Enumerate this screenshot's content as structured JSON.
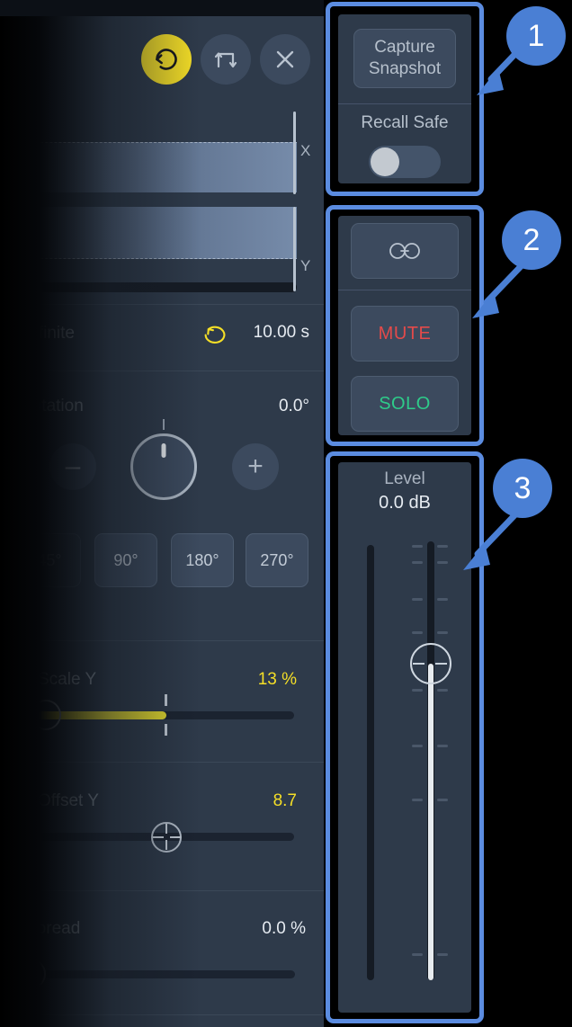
{
  "app": {
    "panel_background": "#2e3a4a",
    "accent_yellow": "#f5df27",
    "accent_blue": "#5b8ce0",
    "mute_color": "#e34a4a",
    "solo_color": "#2ecc8a"
  },
  "transport": {
    "loop_label": "loop-active",
    "bounce_label": "ping-pong",
    "close_label": "close"
  },
  "lanes": {
    "x_label": "X",
    "y_label": "Y"
  },
  "time_row": {
    "mode_label": "s: infinite",
    "loop_icon": "loop-icon",
    "duration": "10.00 s"
  },
  "rotation": {
    "label": "Rotation",
    "value": "0.0°",
    "minus_label": "–",
    "plus_label": "+",
    "presets": [
      {
        "label": "45°",
        "dim": true
      },
      {
        "label": "90°",
        "dim": false
      },
      {
        "label": "180°",
        "dim": false
      },
      {
        "label": "270°",
        "dim": false
      }
    ]
  },
  "scale_y": {
    "label": "Scale Y",
    "value": "13 %"
  },
  "offset_y": {
    "label": "Offset Y",
    "value": "8.7"
  },
  "spread": {
    "label": "Spread",
    "value": "0.0 %"
  },
  "snapshot_group": {
    "capture_line1": "Capture",
    "capture_line2": "Snapshot",
    "recall_safe_label": "Recall Safe",
    "recall_safe_state": "off"
  },
  "channel_group": {
    "link_icon": "link-icon",
    "mute_label": "MUTE",
    "solo_label": "SOLO"
  },
  "level_group": {
    "title": "Level",
    "value": "0.0 dB"
  },
  "annotations": [
    {
      "number": "1"
    },
    {
      "number": "2"
    },
    {
      "number": "3"
    }
  ]
}
